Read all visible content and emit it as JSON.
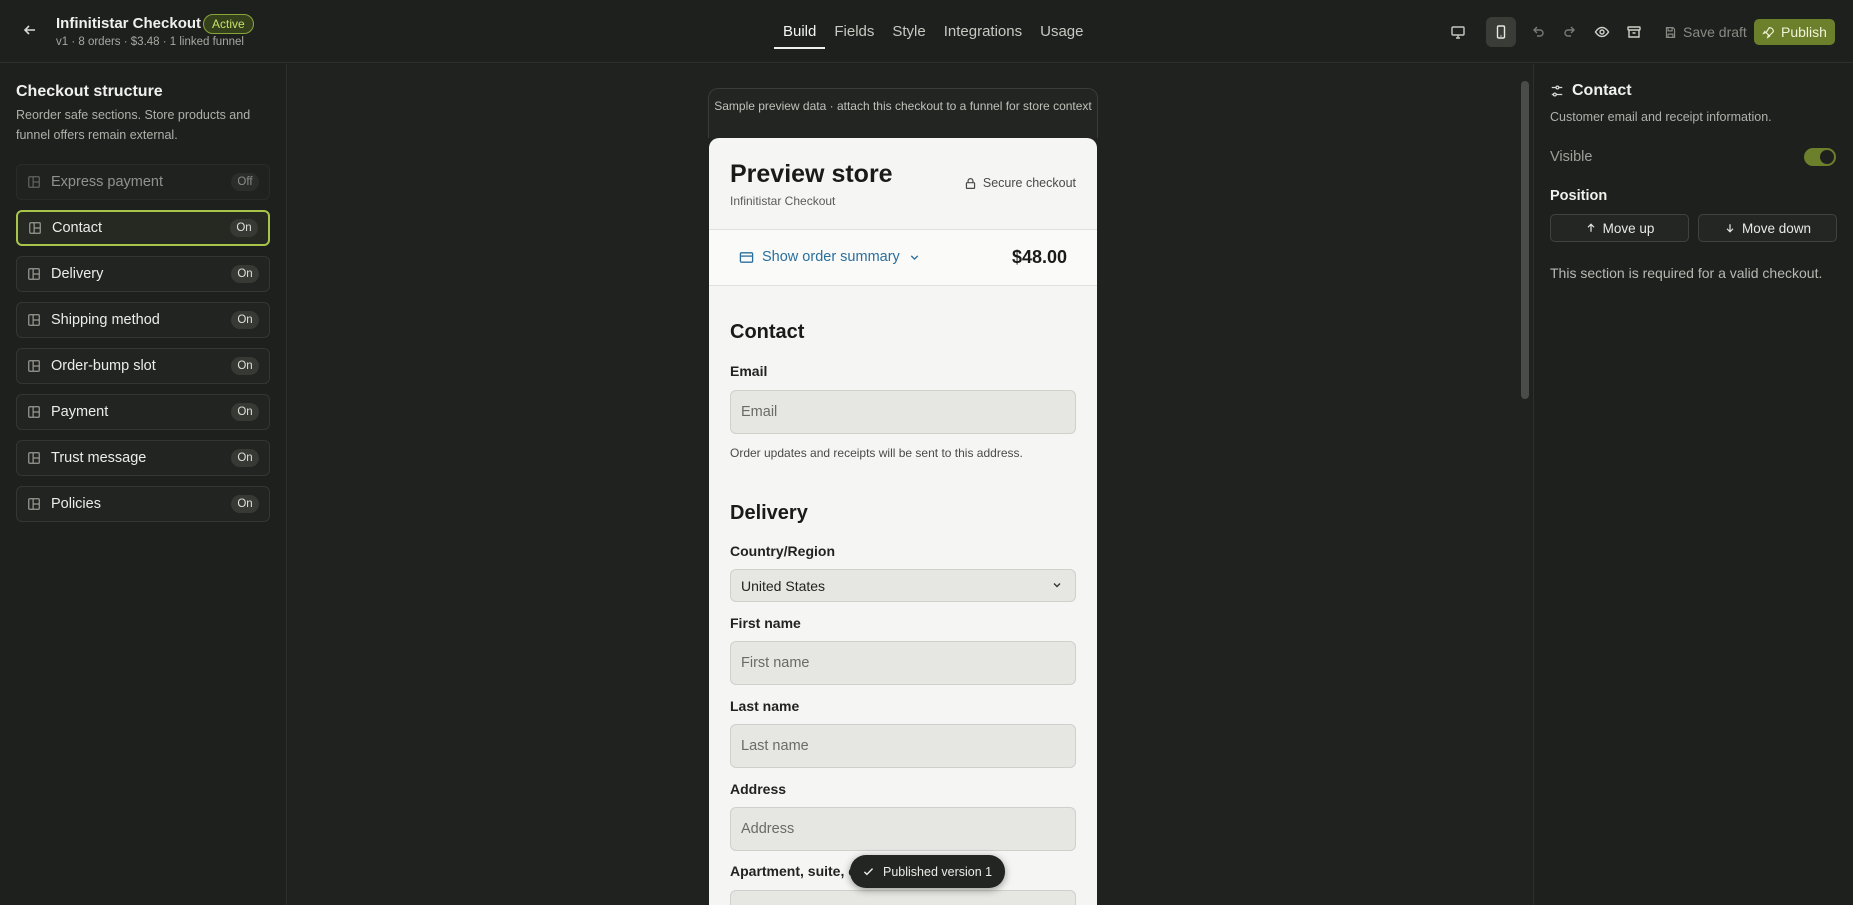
{
  "header": {
    "title": "Infinitistar Checkout",
    "status_badge": "Active",
    "subtitle": "v1 · 8 orders · $3.48 · 1 linked funnel",
    "tabs": [
      {
        "label": "Build",
        "active": true
      },
      {
        "label": "Fields",
        "active": false
      },
      {
        "label": "Style",
        "active": false
      },
      {
        "label": "Integrations",
        "active": false
      },
      {
        "label": "Usage",
        "active": false
      }
    ],
    "toolbar_icons": [
      "desktop-icon",
      "mobile-icon",
      "undo-icon",
      "redo-icon",
      "eye-icon",
      "archive-icon"
    ],
    "save_draft": "Save draft",
    "publish": "Publish"
  },
  "sidebar": {
    "title": "Checkout structure",
    "description": "Reorder safe sections. Store products and funnel offers remain external.",
    "items": [
      {
        "label": "Express payment",
        "state": "Off"
      },
      {
        "label": "Contact",
        "state": "On"
      },
      {
        "label": "Delivery",
        "state": "On"
      },
      {
        "label": "Shipping method",
        "state": "On"
      },
      {
        "label": "Order-bump slot",
        "state": "On"
      },
      {
        "label": "Payment",
        "state": "On"
      },
      {
        "label": "Trust message",
        "state": "On"
      },
      {
        "label": "Policies",
        "state": "On"
      }
    ]
  },
  "preview": {
    "notice": "Sample preview data · attach this checkout to a funnel for store context",
    "store_title": "Preview store",
    "store_subtitle": "Infinitistar Checkout",
    "secure": "Secure checkout",
    "summary_link": "Show order summary",
    "summary_total": "$48.00",
    "contact_heading": "Contact",
    "email_label": "Email",
    "email_placeholder": "Email",
    "email_helper": "Order updates and receipts will be sent to this address.",
    "delivery_heading": "Delivery",
    "country_label": "Country/Region",
    "country_value": "United States",
    "first_name_label": "First name",
    "first_name_placeholder": "First name",
    "last_name_label": "Last name",
    "last_name_placeholder": "Last name",
    "address_label": "Address",
    "address_placeholder": "Address",
    "apartment_label": "Apartment, suite, etc."
  },
  "toast": "Published version 1",
  "inspector": {
    "title": "Contact",
    "description": "Customer email and receipt information.",
    "visible_label": "Visible",
    "visible": true,
    "position_label": "Position",
    "move_up": "Move up",
    "move_down": "Move down",
    "note": "This section is required for a valid checkout."
  },
  "colors": {
    "accent": "#6c7f2a",
    "selected_border": "#a8c44a",
    "link": "#2a6e9e",
    "background": "#1e201e"
  }
}
